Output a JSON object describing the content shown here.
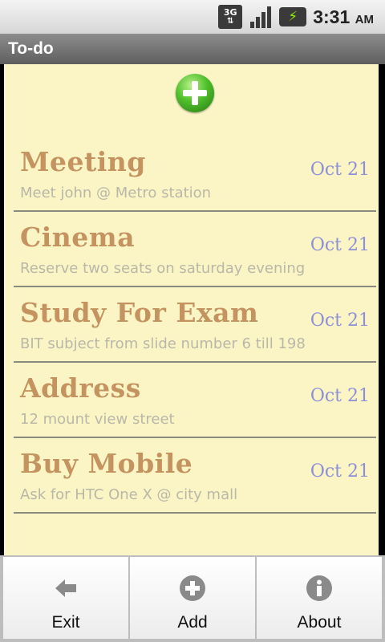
{
  "status_bar": {
    "network": "3G",
    "time": "3:31",
    "ampm": "AM"
  },
  "app": {
    "title": "To-do"
  },
  "todos": [
    {
      "title": "Meeting",
      "description": "Meet john @ Metro station",
      "date": "Oct 21"
    },
    {
      "title": "Cinema",
      "description": "Reserve two seats on saturday evening",
      "date": "Oct 21"
    },
    {
      "title": "Study For Exam",
      "description": "BIT subject from slide number 6 till 198",
      "date": "Oct 21"
    },
    {
      "title": "Address",
      "description": "12 mount view street",
      "date": "Oct 21"
    },
    {
      "title": "Buy Mobile",
      "description": "Ask for HTC One X @ city mall",
      "date": "Oct 21"
    }
  ],
  "menu": {
    "exit_label": "Exit",
    "add_label": "Add",
    "about_label": "About"
  },
  "colors": {
    "note_background": "#fbf5c6",
    "title_text": "#c4935f",
    "date_text": "#8d8fd8",
    "description_text": "#b9b7a8"
  }
}
